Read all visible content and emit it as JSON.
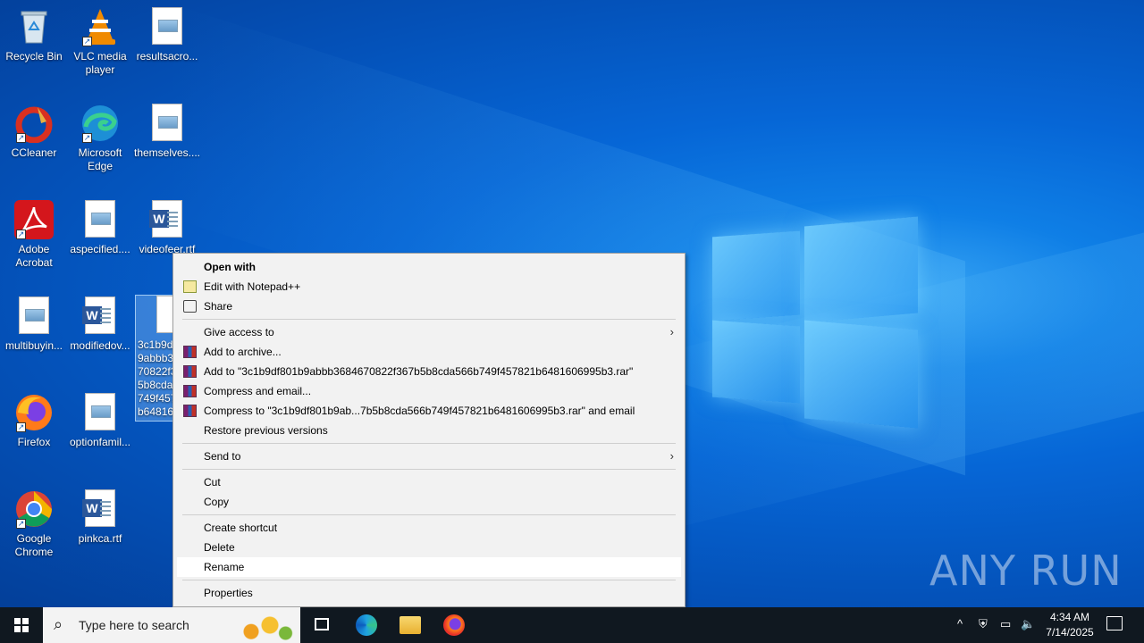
{
  "desktop": {
    "icons": [
      {
        "label": "Recycle Bin",
        "icon": "recycle-bin-icon"
      },
      {
        "label": "VLC media player",
        "icon": "vlc-icon"
      },
      {
        "label": "resultsacro...",
        "icon": "image-file-icon"
      },
      {
        "label": "CCleaner",
        "icon": "ccleaner-icon"
      },
      {
        "label": "Microsoft Edge",
        "icon": "edge-icon"
      },
      {
        "label": "themselves....",
        "icon": "image-file-icon"
      },
      {
        "label": "Adobe Acrobat",
        "icon": "acrobat-icon"
      },
      {
        "label": "aspecified....",
        "icon": "image-file-icon"
      },
      {
        "label": "videofeer.rtf",
        "icon": "word-doc-icon"
      },
      {
        "label": "multibuyin...",
        "icon": "image-file-icon"
      },
      {
        "label": "modifiedov...",
        "icon": "word-doc-icon"
      },
      {
        "label": "3c1b9df801b9abbb3684670822f367b5b8cda566b749f457821b6481606995b3",
        "icon": "blank-file-icon"
      },
      {
        "label": "Firefox",
        "icon": "firefox-icon"
      },
      {
        "label": "optionfamil...",
        "icon": "image-file-icon"
      },
      {
        "label": "Google Chrome",
        "icon": "chrome-icon"
      },
      {
        "label": "pinkca.rtf",
        "icon": "word-doc-icon"
      }
    ],
    "watermark": "ANY RUN"
  },
  "context_menu": {
    "items": [
      {
        "label": "Open with",
        "bold": true
      },
      {
        "label": "Edit with Notepad++",
        "icon": "notepadpp-icon"
      },
      {
        "label": "Share",
        "icon": "share-icon"
      },
      {
        "label": "Give access to",
        "submenu": true
      },
      {
        "label": "Add to archive...",
        "icon": "winrar-icon"
      },
      {
        "label": "Add to \"3c1b9df801b9abbb3684670822f367b5b8cda566b749f457821b6481606995b3.rar\"",
        "icon": "winrar-icon"
      },
      {
        "label": "Compress and email...",
        "icon": "winrar-icon"
      },
      {
        "label": "Compress to \"3c1b9df801b9ab...7b5b8cda566b749f457821b6481606995b3.rar\" and email",
        "icon": "winrar-icon"
      },
      {
        "label": "Restore previous versions"
      },
      {
        "label": "Send to",
        "submenu": true
      },
      {
        "label": "Cut"
      },
      {
        "label": "Copy"
      },
      {
        "label": "Create shortcut"
      },
      {
        "label": "Delete"
      },
      {
        "label": "Rename",
        "hovered": true
      },
      {
        "label": "Properties"
      }
    ]
  },
  "taskbar": {
    "search_placeholder": "Type here to search",
    "pinned": [
      {
        "name": "Microsoft Edge",
        "icon": "edge-icon"
      },
      {
        "name": "File Explorer",
        "icon": "folder-icon"
      },
      {
        "name": "Firefox",
        "icon": "firefox-icon"
      }
    ],
    "time": "4:34 AM",
    "date": "7/14/2025"
  }
}
